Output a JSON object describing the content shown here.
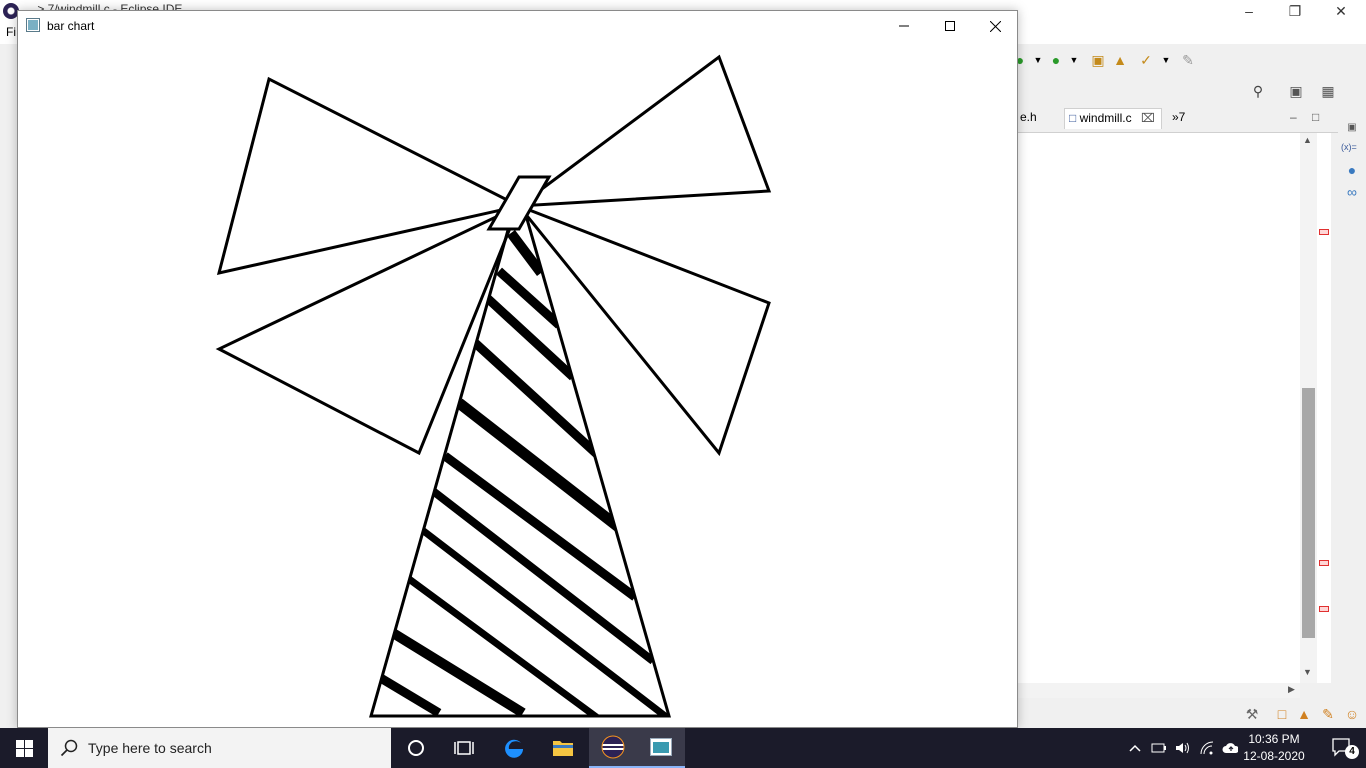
{
  "ide": {
    "title_fragment": "... > 7/windmill.c - Eclipse IDE",
    "menu_first": "Fi",
    "tabs": [
      {
        "label": "e.h"
      },
      {
        "label": "windmill.c"
      },
      {
        "label": "»7"
      }
    ],
    "right_toolbar_label": "(x)="
  },
  "app": {
    "title": "bar chart"
  },
  "taskbar": {
    "search_placeholder": "Type here to search",
    "time": "10:36 PM",
    "date": "12-08-2020",
    "notification_count": "4"
  },
  "colors": {
    "taskbar_bg": "#1b1b2a",
    "accent": "#0078d7"
  }
}
